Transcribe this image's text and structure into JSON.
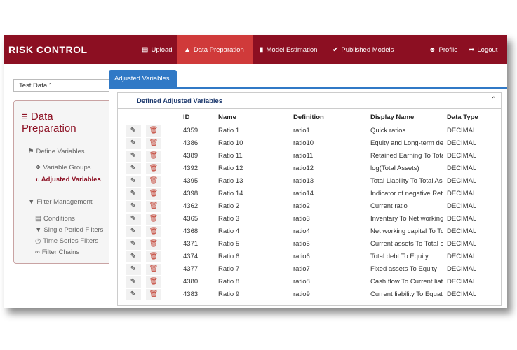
{
  "brand": "RISK CONTROL",
  "nav": [
    {
      "label": "Upload",
      "icon": "upload-icon"
    },
    {
      "label": "Data Preparation",
      "icon": "sitemap-icon"
    },
    {
      "label": "Model Estimation",
      "icon": "bar-chart-icon"
    },
    {
      "label": "Published Models",
      "icon": "check-circle-icon"
    },
    {
      "label": "Profile",
      "icon": "user-icon"
    },
    {
      "label": "Logout",
      "icon": "logout-icon"
    }
  ],
  "dataset": "Test Data 1",
  "sidebar": {
    "title_line1": "Data",
    "title_line2": "Preparation",
    "define_variables": "Define Variables",
    "variable_groups": "Variable Groups",
    "adjusted_variables": "Adjusted Variables",
    "filter_management": "Filter Management",
    "conditions": "Conditions",
    "single_period_filters": "Single Period Filters",
    "time_series_filters": "Time Series Filters",
    "filter_chains": "Filter Chains"
  },
  "tab": "Adjusted Variables",
  "panel_title": "Defined Adjusted Variables",
  "columns": [
    "ID",
    "Name",
    "Definition",
    "Display Name",
    "Data Type"
  ],
  "rows": [
    [
      "4359",
      "Ratio 1",
      "ratio1",
      "Quick ratios",
      "DECIMAL"
    ],
    [
      "4386",
      "Ratio 10",
      "ratio10",
      "Equity and Long-term de",
      "DECIMAL"
    ],
    [
      "4389",
      "Ratio 11",
      "ratio11",
      "Retained Earning To Tota",
      "DECIMAL"
    ],
    [
      "4392",
      "Ratio 12",
      "ratio12",
      "log(Total Assets)",
      "DECIMAL"
    ],
    [
      "4395",
      "Ratio 13",
      "ratio13",
      "Total Liability To Total As",
      "DECIMAL"
    ],
    [
      "4398",
      "Ratio 14",
      "ratio14",
      "Indicator of negative Ret",
      "DECIMAL"
    ],
    [
      "4362",
      "Ratio 2",
      "ratio2",
      "Current ratio",
      "DECIMAL"
    ],
    [
      "4365",
      "Ratio 3",
      "ratio3",
      "Inventary To Net working",
      "DECIMAL"
    ],
    [
      "4368",
      "Ratio 4",
      "ratio4",
      "Net working capital To To",
      "DECIMAL"
    ],
    [
      "4371",
      "Ratio 5",
      "ratio5",
      "Current assets To Total c",
      "DECIMAL"
    ],
    [
      "4374",
      "Ratio 6",
      "ratio6",
      "Total debt To Equity",
      "DECIMAL"
    ],
    [
      "4377",
      "Ratio 7",
      "ratio7",
      "Fixed assets To Equity",
      "DECIMAL"
    ],
    [
      "4380",
      "Ratio 8",
      "ratio8",
      "Cash flow To Current liat",
      "DECIMAL"
    ],
    [
      "4383",
      "Ratio 9",
      "ratio9",
      "Current liability To Equat",
      "DECIMAL"
    ]
  ]
}
